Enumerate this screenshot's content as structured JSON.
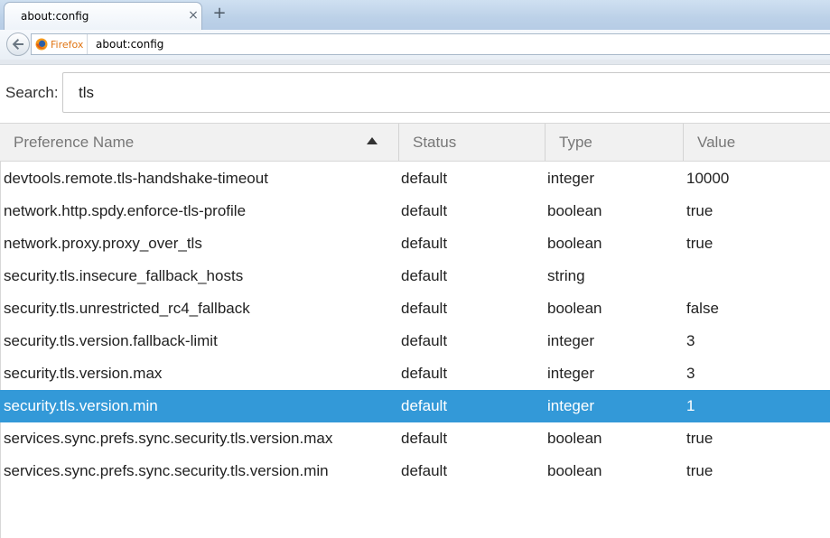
{
  "tabs": [
    {
      "title": "about:config",
      "close": "×"
    }
  ],
  "new_tab_label": "+",
  "navbar": {
    "identity_label": "Firefox",
    "url": "about:config"
  },
  "search": {
    "label": "Search:",
    "value": "tls"
  },
  "table": {
    "columns": [
      "Preference Name",
      "Status",
      "Type",
      "Value"
    ],
    "sort": {
      "column": "Preference Name",
      "direction": "ascending"
    },
    "selected_index": 7,
    "rows": [
      {
        "name": "devtools.remote.tls-handshake-timeout",
        "status": "default",
        "type": "integer",
        "value": "10000"
      },
      {
        "name": "network.http.spdy.enforce-tls-profile",
        "status": "default",
        "type": "boolean",
        "value": "true"
      },
      {
        "name": "network.proxy.proxy_over_tls",
        "status": "default",
        "type": "boolean",
        "value": "true"
      },
      {
        "name": "security.tls.insecure_fallback_hosts",
        "status": "default",
        "type": "string",
        "value": ""
      },
      {
        "name": "security.tls.unrestricted_rc4_fallback",
        "status": "default",
        "type": "boolean",
        "value": "false"
      },
      {
        "name": "security.tls.version.fallback-limit",
        "status": "default",
        "type": "integer",
        "value": "3"
      },
      {
        "name": "security.tls.version.max",
        "status": "default",
        "type": "integer",
        "value": "3"
      },
      {
        "name": "security.tls.version.min",
        "status": "default",
        "type": "integer",
        "value": "1"
      },
      {
        "name": "services.sync.prefs.sync.security.tls.version.max",
        "status": "default",
        "type": "boolean",
        "value": "true"
      },
      {
        "name": "services.sync.prefs.sync.security.tls.version.min",
        "status": "default",
        "type": "boolean",
        "value": "true"
      }
    ]
  },
  "colors": {
    "selection": "#3399d8",
    "identity_orange": "#e07412"
  },
  "icons": {
    "back": "back-arrow-icon",
    "identity": "firefox-icon",
    "sort": "sort-ascending-icon"
  }
}
